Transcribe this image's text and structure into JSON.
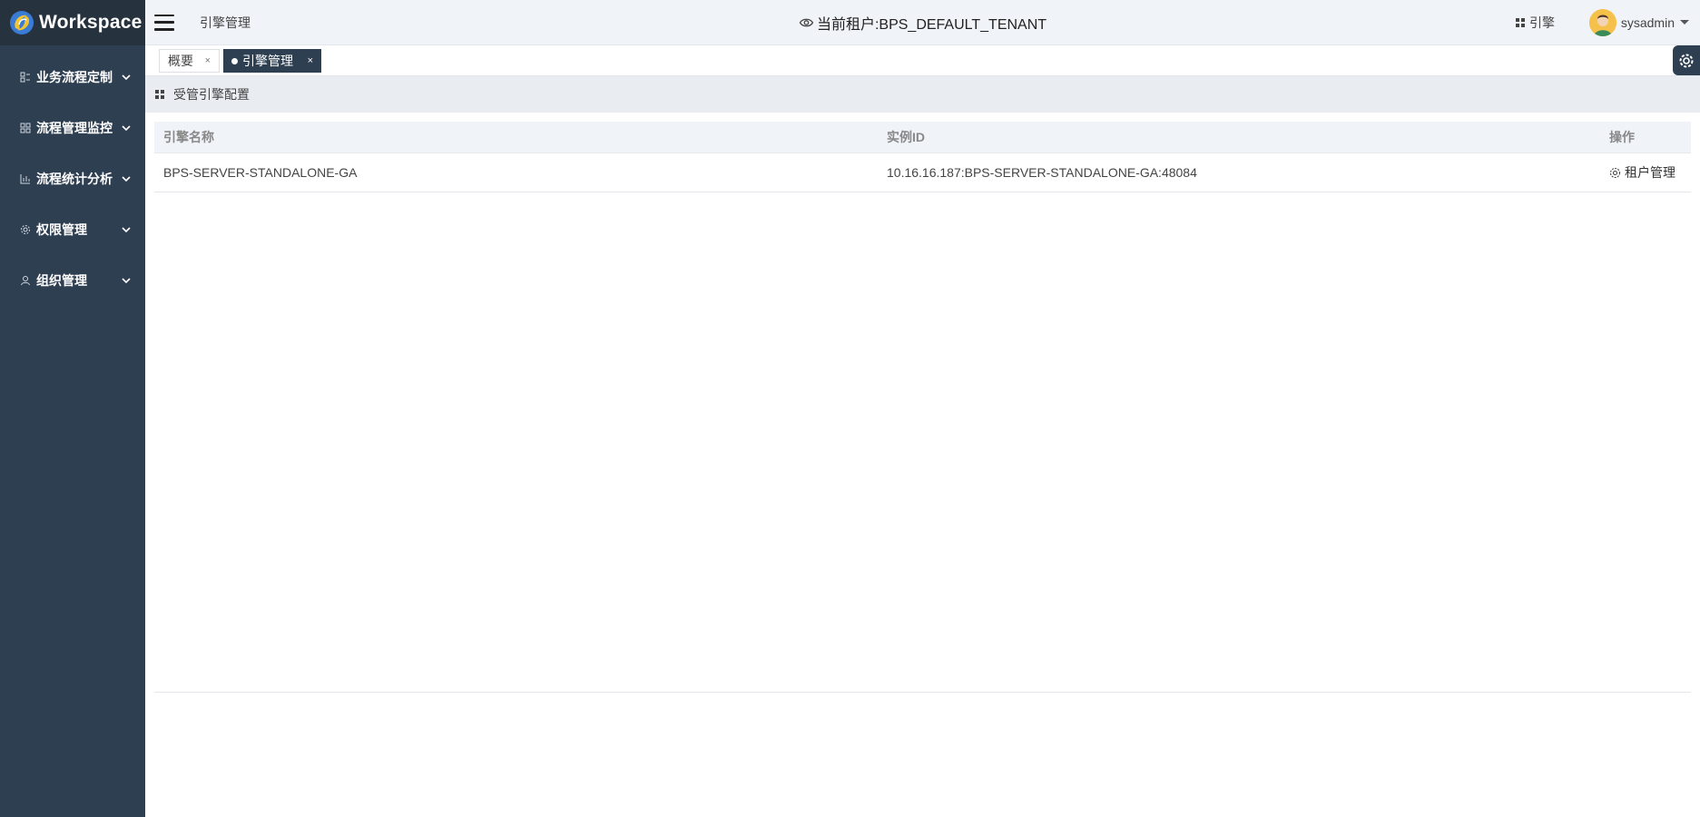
{
  "app": {
    "title": "Workspace"
  },
  "sidebar": {
    "items": [
      {
        "label": "业务流程定制",
        "icon": "process-custom-icon"
      },
      {
        "label": "流程管理监控",
        "icon": "monitor-icon"
      },
      {
        "label": "流程统计分析",
        "icon": "chart-icon"
      },
      {
        "label": "权限管理",
        "icon": "gear-icon"
      },
      {
        "label": "组织管理",
        "icon": "user-icon"
      }
    ]
  },
  "header": {
    "breadcrumb": "引擎管理",
    "tenant": "当前租户:BPS_DEFAULT_TENANT",
    "engine_link": "引擎",
    "username": "sysadmin"
  },
  "tabs": [
    {
      "label": "概要",
      "close": "×"
    },
    {
      "label": "引擎管理",
      "close": "×"
    }
  ],
  "section": {
    "title": "受管引擎配置"
  },
  "table": {
    "columns": [
      "引擎名称",
      "实例ID",
      "操作"
    ],
    "rows": [
      {
        "name": "BPS-SERVER-STANDALONE-GA",
        "instance_id": "10.16.16.187:BPS-SERVER-STANDALONE-GA:48084",
        "action": "租户管理"
      }
    ]
  },
  "colors": {
    "sidebar": "#2f3f52",
    "header": "#f0f3f8",
    "active_tab": "#2f3f52"
  }
}
